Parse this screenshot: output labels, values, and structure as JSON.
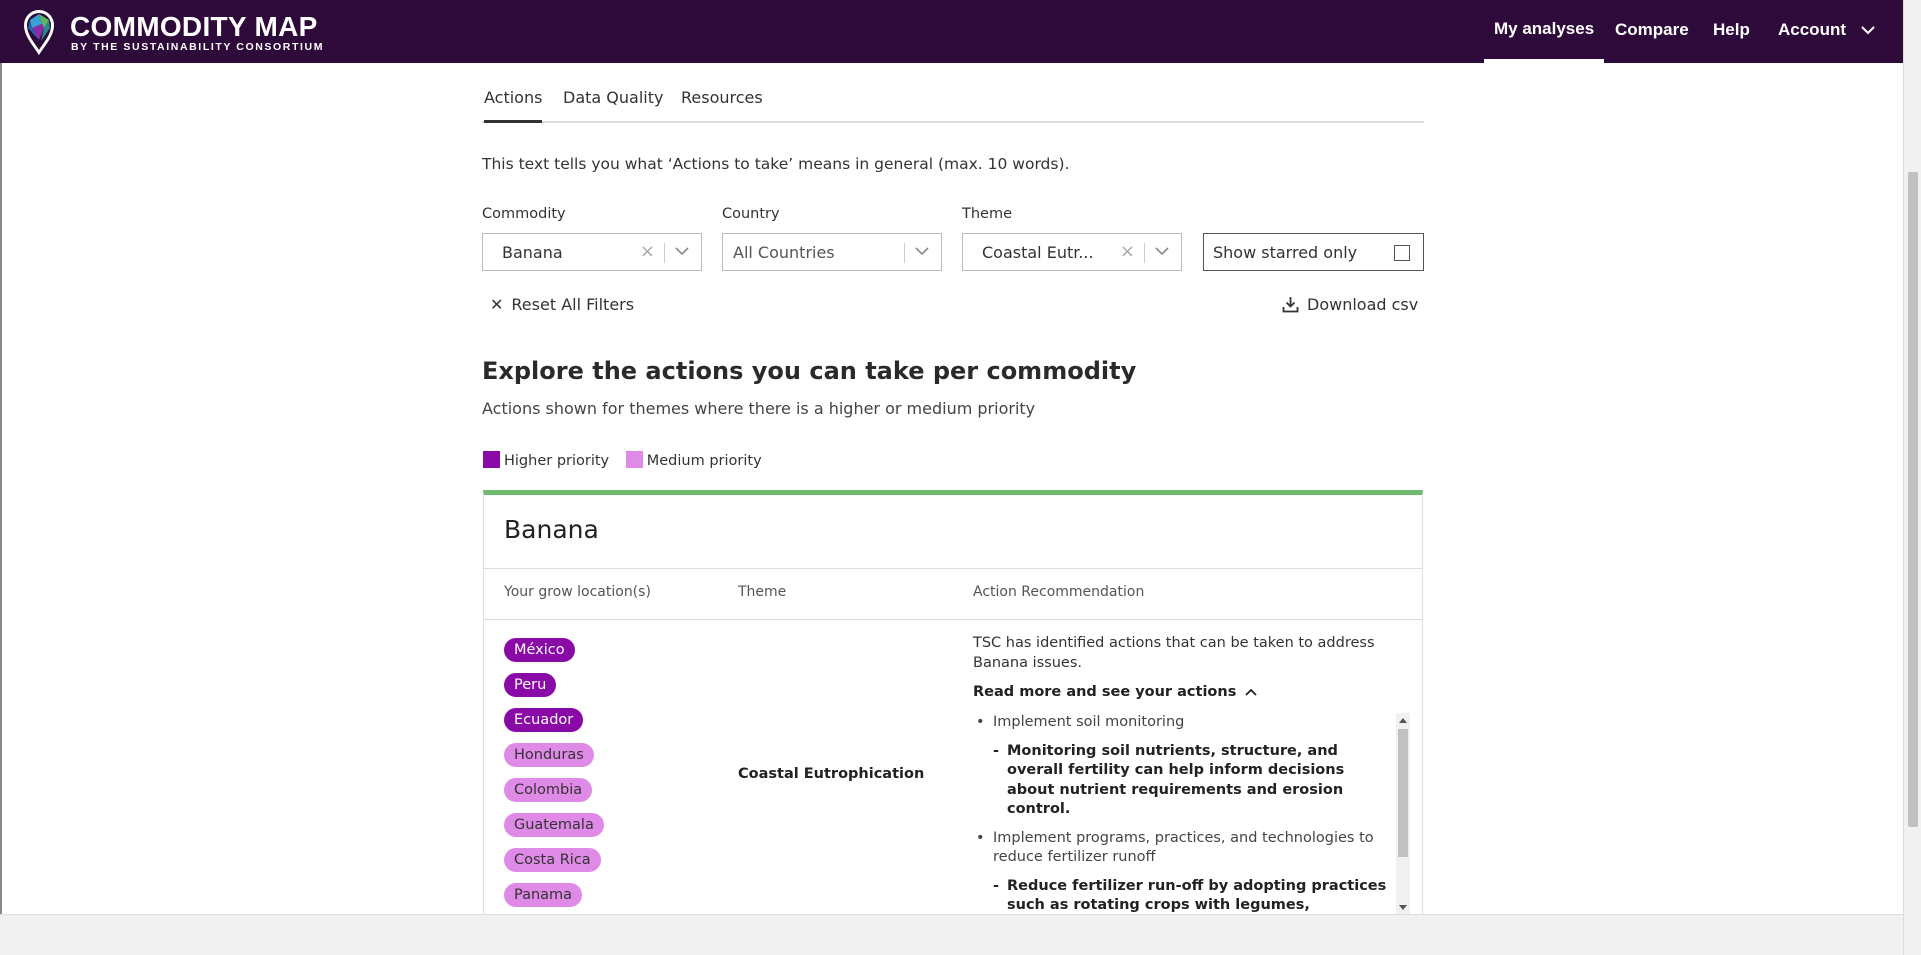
{
  "header": {
    "brand_title": "COMMODITY MAP",
    "brand_subtitle": "BY THE SUSTAINABILITY CONSORTIUM",
    "nav": [
      "My analyses",
      "Compare",
      "Help",
      "Account"
    ],
    "active_nav": "My analyses"
  },
  "tabs": [
    "Actions",
    "Data Quality",
    "Resources"
  ],
  "active_tab": "Actions",
  "intro": "This text tells you what ‘Actions to take’ means in general (max. 10 words).",
  "filters": {
    "commodity": {
      "label": "Commodity",
      "value": "Banana"
    },
    "country": {
      "label": "Country",
      "placeholder": "All Countries"
    },
    "theme": {
      "label": "Theme",
      "value": "Coastal Eutr..."
    },
    "starred": {
      "label": "Show starred only",
      "checked": false
    }
  },
  "reset_label": "Reset All Filters",
  "download_label": "Download csv",
  "section": {
    "title": "Explore the actions you can take per commodity",
    "subtitle": "Actions shown for themes where there is a higher or medium priority"
  },
  "legend": {
    "higher": {
      "label": "Higher priority",
      "color": "#8a0aa8"
    },
    "medium": {
      "label": "Medium priority",
      "color": "#e08ae8"
    }
  },
  "card": {
    "title": "Banana",
    "accent_color": "#6fba6c",
    "columns": [
      "Your grow location(s)",
      "Theme",
      "Action Recommendation"
    ],
    "locations": [
      {
        "name": "México",
        "priority": "higher"
      },
      {
        "name": "Peru",
        "priority": "higher"
      },
      {
        "name": "Ecuador",
        "priority": "higher"
      },
      {
        "name": "Honduras",
        "priority": "medium"
      },
      {
        "name": "Colombia",
        "priority": "medium"
      },
      {
        "name": "Guatemala",
        "priority": "medium"
      },
      {
        "name": "Costa Rica",
        "priority": "medium"
      },
      {
        "name": "Panama",
        "priority": "medium"
      }
    ],
    "theme": "Coastal Eutrophication",
    "recommendation": "TSC has identified actions that can be taken to address Banana issues.",
    "read_more": "Read more and see your actions",
    "actions": [
      {
        "title": "Implement soil monitoring",
        "detail": "Monitoring soil nutrients, structure, and overall fertility can help inform decisions about nutrient requirements and erosion control."
      },
      {
        "title": "Implement programs, practices, and technologies to reduce fertilizer runoff",
        "detail": "Reduce fertilizer run-off by adopting practices such as rotating crops with legumes, implementing cover cropping, accounting for weather prior to application, mitigating land affected by hurricanes."
      }
    ]
  }
}
